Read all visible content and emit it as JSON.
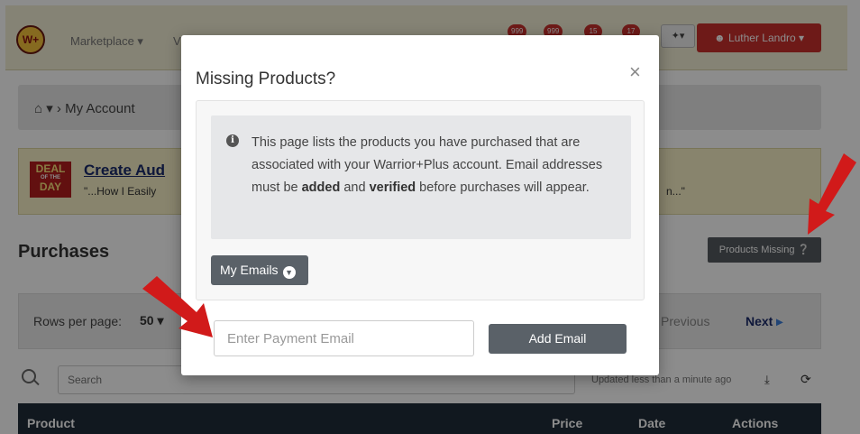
{
  "navbar": {
    "logo_text": "W+",
    "marketplace_label": "Marketplace ▾",
    "second_link_label": "V",
    "badges": [
      "999",
      "999",
      "15",
      "17"
    ],
    "user_label": "Luther Landro ▾"
  },
  "breadcrumb": {
    "text": "My Account"
  },
  "deal": {
    "badge_top": "DEAL",
    "badge_mid": "OF THE",
    "badge_bottom": "DAY",
    "title": "Create Aud",
    "subtitle": "\"...How I Easily",
    "subtitle_end": "n...\""
  },
  "purchases": {
    "title": "Purchases",
    "products_missing_label": "Products Missing"
  },
  "pagination": {
    "rows_label": "Rows per page:",
    "rows_value": "50 ▾",
    "previous_label": "Previous",
    "next_label": "Next"
  },
  "toolbar": {
    "search_placeholder": "Search",
    "updated_text": "Updated less than a minute ago"
  },
  "table": {
    "headers": [
      "Product",
      "Price",
      "Date",
      "Actions"
    ]
  },
  "modal": {
    "title": "Missing Products?",
    "close_glyph": "×",
    "info_text_1": "This page lists the products you have purchased that are associated with your Warrior+Plus account. Email addresses must be ",
    "info_bold_1": "added",
    "info_text_2": " and ",
    "info_bold_2": "verified",
    "info_text_3": " before purchases will appear.",
    "my_emails_label": "My Emails",
    "email_placeholder": "Enter Payment Email",
    "add_email_label": "Add Email"
  },
  "colors": {
    "accent_red": "#c9302c",
    "arrow_red": "#d11a1a",
    "button_gray": "#5a6168",
    "navbar_bg": "#f3efd5",
    "table_head_bg": "#1f2d3a"
  }
}
